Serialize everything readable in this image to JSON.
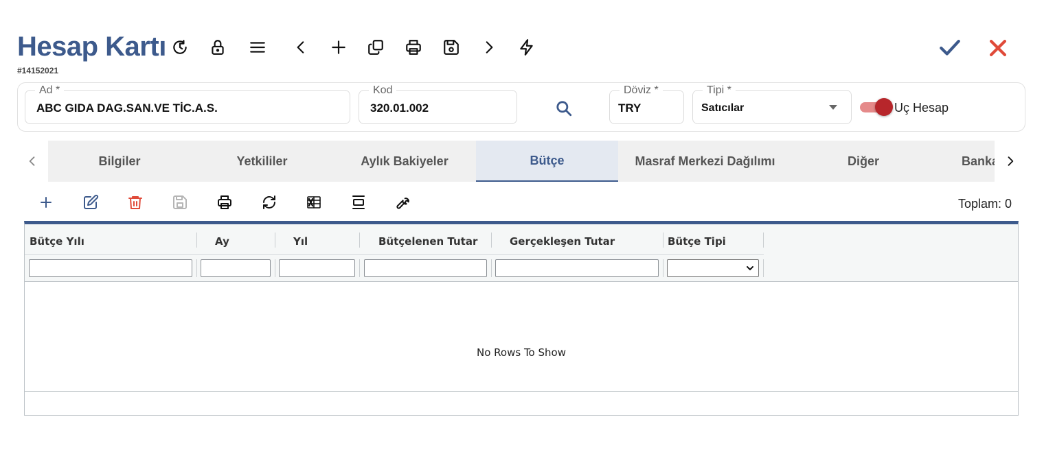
{
  "header": {
    "title": "Hesap Kartı",
    "record_id": "#14152021",
    "icons": [
      "history-icon",
      "lock-icon",
      "menu-icon",
      "chevron-left-icon",
      "plus-icon",
      "copy-icon",
      "print-icon",
      "save-icon",
      "chevron-right-icon",
      "bolt-icon"
    ],
    "confirm_icon": "check-icon",
    "cancel_icon": "close-icon",
    "confirm_color": "#3d5a8c",
    "cancel_color": "#e04b3a"
  },
  "form": {
    "ad": {
      "label": "Ad *",
      "value": "ABC GIDA DAG.SAN.VE TİC.A.S."
    },
    "kod": {
      "label": "Kod",
      "value": "320.01.002"
    },
    "doviz": {
      "label": "Döviz *",
      "value": "TRY"
    },
    "tipi": {
      "label": "Tipi *",
      "value": "Satıcılar"
    },
    "uc_hesap": {
      "label": "Uç Hesap",
      "checked": true
    }
  },
  "tabs": {
    "items": [
      {
        "label": "Bilgiler"
      },
      {
        "label": "Yetkililer"
      },
      {
        "label": "Aylık Bakiyeler"
      },
      {
        "label": "Bütçe",
        "active": true
      },
      {
        "label": "Masraf Merkezi Dağılımı"
      },
      {
        "label": "Diğer"
      },
      {
        "label": "Banka"
      }
    ]
  },
  "toolbar": {
    "icons": [
      "add-icon",
      "edit-icon",
      "delete-icon",
      "save-icon",
      "print-icon",
      "refresh-icon",
      "excel-icon",
      "align-icon",
      "settings-wrench-icon"
    ],
    "total_label": "Toplam: 0"
  },
  "grid": {
    "columns": [
      "Bütçe Yılı",
      "Ay",
      "Yıl",
      "Bütçelenen Tutar",
      "Gerçekleşen Tutar",
      "Bütçe Tipi"
    ],
    "empty_text": "No Rows To Show"
  },
  "colors": {
    "primary": "#3d5a8c",
    "danger": "#e04b3a",
    "toggle_on": "#b7262b"
  }
}
